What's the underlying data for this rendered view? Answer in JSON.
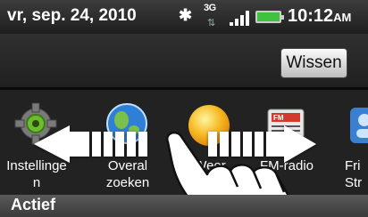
{
  "status_bar": {
    "date": "vr, sep. 24, 2010",
    "network_type": "3G",
    "network_activity": "⇅",
    "time": "10:12",
    "ampm": "AM",
    "icons": [
      "bluetooth-icon",
      "3g-data-icon",
      "signal-strength-icon",
      "battery-icon"
    ],
    "battery_color": "#3fc23f"
  },
  "header": {
    "clear_button_label": "Wissen"
  },
  "apps": [
    {
      "label": "Instellinge\nn",
      "icon": "gear-icon"
    },
    {
      "label": "Overal\nzoeken",
      "icon": "globe-search-icon"
    },
    {
      "label": "Weer",
      "icon": "sun-weather-icon"
    },
    {
      "label": "FM-radio",
      "icon": "fm-radio-icon"
    },
    {
      "label": "Fri\nStr",
      "icon": "friend-stream-icon"
    }
  ],
  "gesture": {
    "icon": "swipe-left-right-gesture-icon",
    "arrow_color": "#ffffff"
  },
  "section": {
    "title": "Actief"
  }
}
